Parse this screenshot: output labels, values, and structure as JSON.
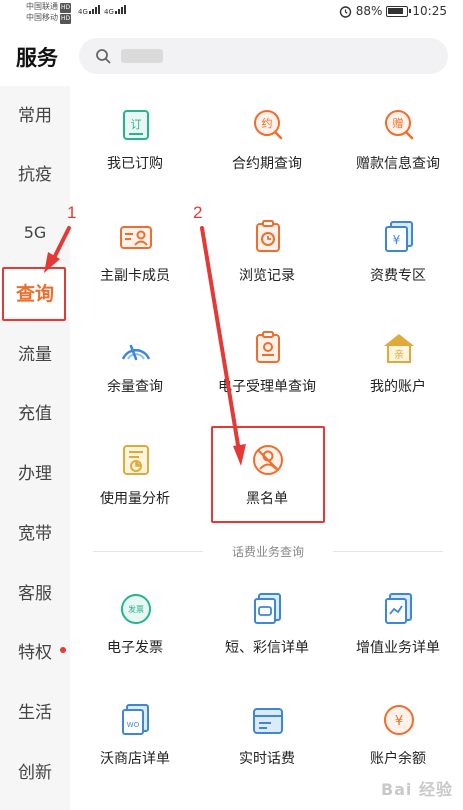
{
  "status_bar": {
    "carrier1": "中国联通",
    "carrier2": "中国移动",
    "hd": "HD",
    "net": "4G",
    "battery": "88%",
    "time": "10:25"
  },
  "header": {
    "title": "服务"
  },
  "sidebar": {
    "items": [
      {
        "label": "常用"
      },
      {
        "label": "抗疫"
      },
      {
        "label": "5G"
      },
      {
        "label": "查询",
        "active": true
      },
      {
        "label": "流量"
      },
      {
        "label": "充值"
      },
      {
        "label": "办理"
      },
      {
        "label": "宽带"
      },
      {
        "label": "客服"
      },
      {
        "label": "特权",
        "dot": true
      },
      {
        "label": "生活"
      },
      {
        "label": "创新"
      }
    ]
  },
  "grid": {
    "items": [
      {
        "label": "我已订购",
        "icon": "subscription-icon",
        "glyph": "订"
      },
      {
        "label": "合约期查询",
        "icon": "contract-icon",
        "glyph": "约"
      },
      {
        "label": "赠款信息查询",
        "icon": "gift-money-icon",
        "glyph": "赠"
      },
      {
        "label": "主副卡成员",
        "icon": "member-card-icon"
      },
      {
        "label": "浏览记录",
        "icon": "history-clock-icon"
      },
      {
        "label": "资费专区",
        "icon": "tariff-icon",
        "glyph": "¥"
      },
      {
        "label": "余量查询",
        "icon": "gauge-icon"
      },
      {
        "label": "电子受理单查询",
        "icon": "receipt-icon"
      },
      {
        "label": "我的账户",
        "icon": "house-account-icon",
        "glyph": "亲"
      },
      {
        "label": "使用量分析",
        "icon": "usage-chart-icon"
      },
      {
        "label": "黑名单",
        "icon": "blacklist-user-icon"
      }
    ]
  },
  "section": {
    "title": "话费业务查询"
  },
  "grid2": {
    "items": [
      {
        "label": "电子发票",
        "icon": "invoice-icon",
        "glyph": "发票"
      },
      {
        "label": "短、彩信详单",
        "icon": "sms-detail-icon"
      },
      {
        "label": "增值业务详单",
        "icon": "value-added-icon"
      },
      {
        "label": "沃商店详单",
        "icon": "wo-store-icon",
        "glyph": "WO"
      },
      {
        "label": "实时话费",
        "icon": "realtime-fee-icon"
      },
      {
        "label": "账户余额",
        "icon": "balance-icon",
        "glyph": "¥"
      }
    ]
  },
  "annotations": {
    "n1": "1",
    "n2": "2"
  },
  "watermark": "Bai 经验",
  "colors": {
    "accent": "#ef6d2d",
    "teal": "#27b38f",
    "blue": "#3e86d6",
    "gold": "#e0a93b",
    "red": "#e53935"
  }
}
